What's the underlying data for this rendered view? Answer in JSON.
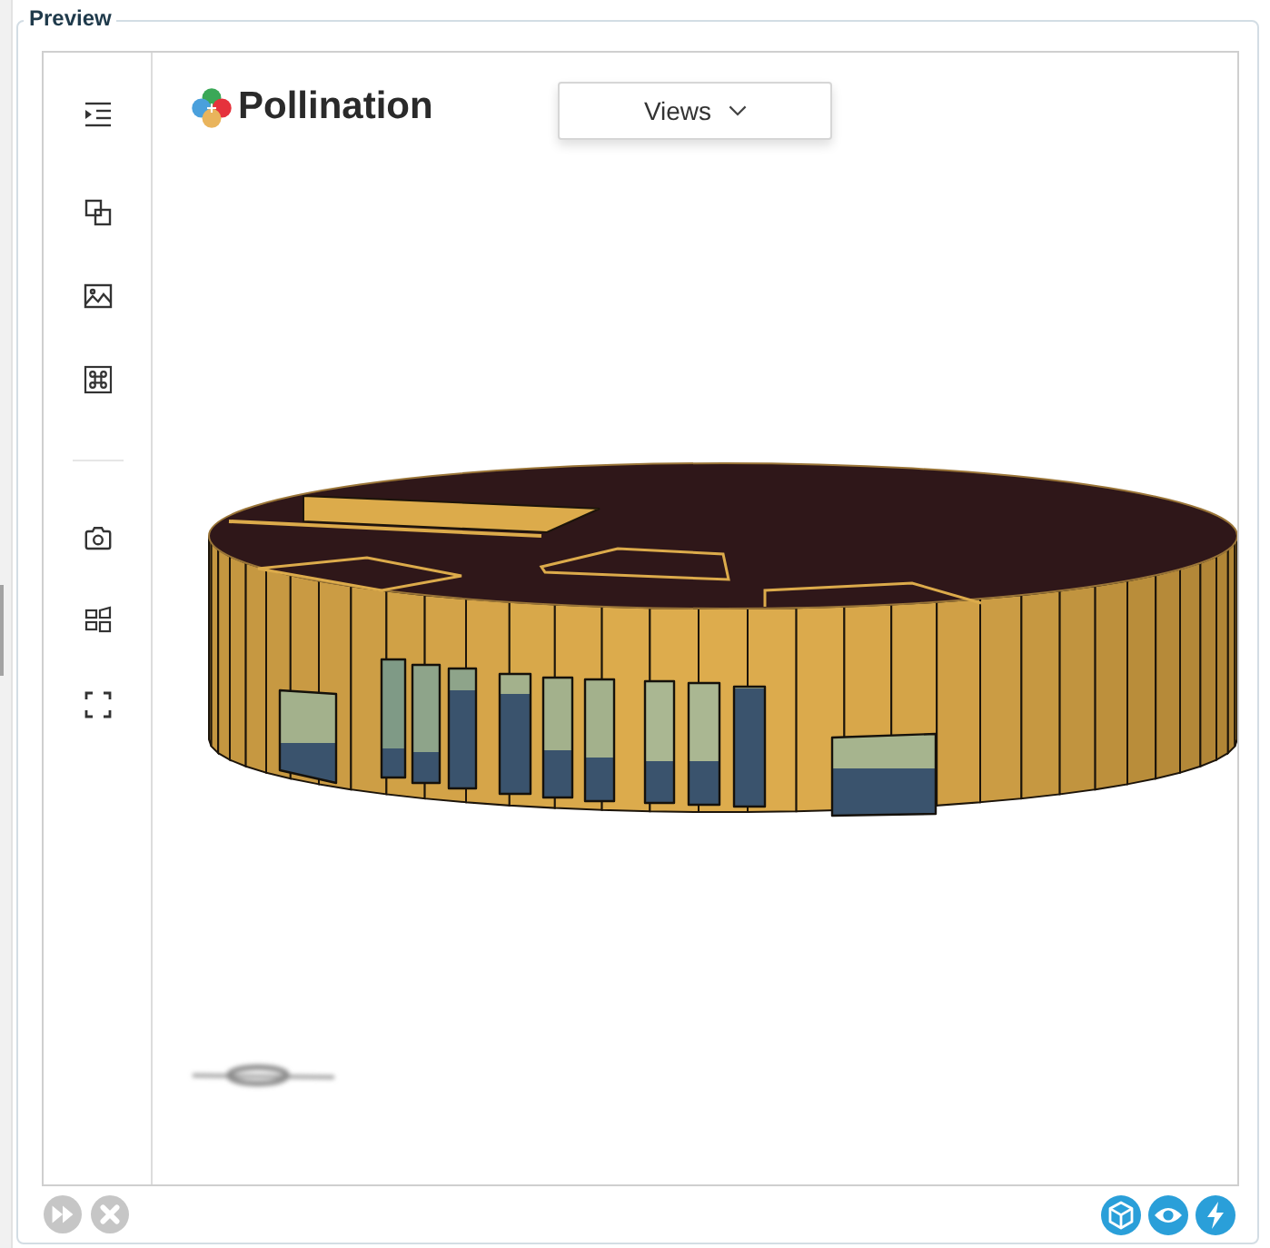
{
  "panel": {
    "title": "Preview"
  },
  "viewer": {
    "logo": {
      "text": "Pollination"
    },
    "views_menu": {
      "label": "Views"
    }
  }
}
